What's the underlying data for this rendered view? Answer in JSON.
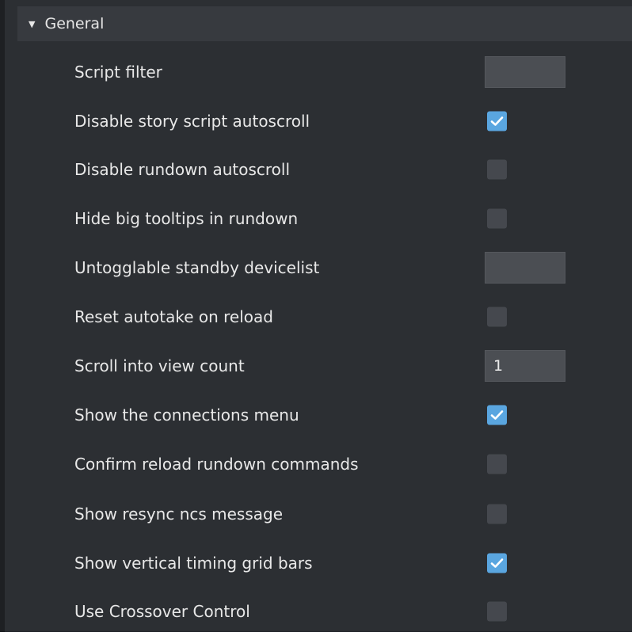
{
  "section": {
    "title": "General",
    "expanded": true
  },
  "settings": [
    {
      "label": "Script filter",
      "control": "text",
      "value": ""
    },
    {
      "label": "Disable story script autoscroll",
      "control": "checkbox",
      "checked": true
    },
    {
      "label": "Disable rundown autoscroll",
      "control": "checkbox",
      "checked": false
    },
    {
      "label": "Hide big tooltips in rundown",
      "control": "checkbox",
      "checked": false
    },
    {
      "label": "Untogglable standby devicelist",
      "control": "text",
      "value": ""
    },
    {
      "label": "Reset autotake on reload",
      "control": "checkbox",
      "checked": false
    },
    {
      "label": "Scroll into view count",
      "control": "text",
      "value": "1"
    },
    {
      "label": "Show the connections menu",
      "control": "checkbox",
      "checked": true
    },
    {
      "label": "Confirm reload rundown commands",
      "control": "checkbox",
      "checked": false
    },
    {
      "label": "Show resync ncs message",
      "control": "checkbox",
      "checked": false
    },
    {
      "label": "Show vertical timing grid bars",
      "control": "checkbox",
      "checked": true
    },
    {
      "label": "Use Crossover Control",
      "control": "checkbox",
      "checked": false
    }
  ],
  "colors": {
    "background": "#2c2f33",
    "header": "#373a3f",
    "checkbox_checked": "#5aa6e0",
    "checkbox_unchecked": "#45484e"
  }
}
